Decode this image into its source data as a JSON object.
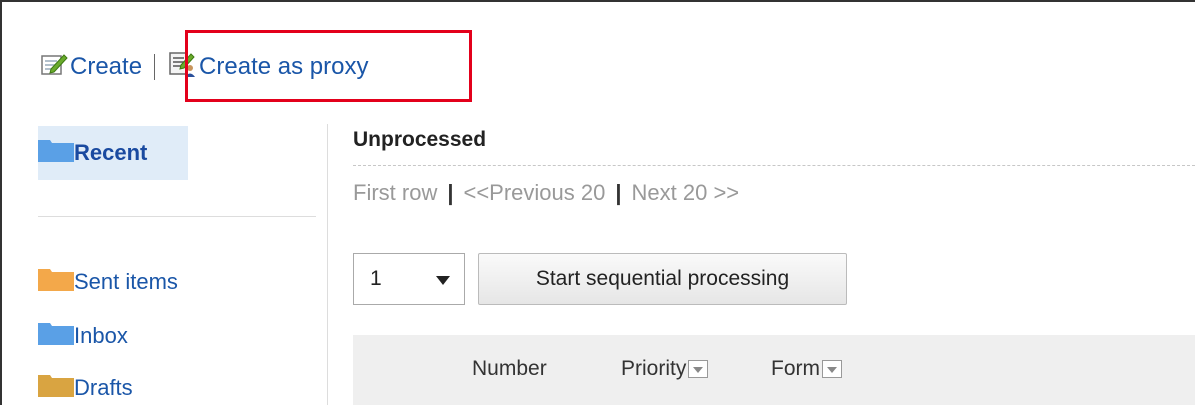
{
  "toolbar": {
    "create_label": "Create",
    "create_proxy_label": "Create as proxy"
  },
  "sidebar": {
    "recent_label": "Recent",
    "items": [
      {
        "label": "Sent items",
        "icon": "folder-orange-icon",
        "color": "#f3a84a"
      },
      {
        "label": "Inbox",
        "icon": "folder-blue-icon",
        "color": "#5aa0e6"
      },
      {
        "label": "Drafts",
        "icon": "folder-tan-icon",
        "color": "#d9a441"
      }
    ]
  },
  "main": {
    "title": "Unprocessed",
    "pager": {
      "first": "First row",
      "sep": "|",
      "prev": "<<Previous 20",
      "next": "Next 20 >>"
    },
    "select_value": "1",
    "sequential_button": "Start sequential processing",
    "columns": {
      "number": "Number",
      "priority": "Priority",
      "form": "Form"
    }
  },
  "colors": {
    "link": "#1a56a8",
    "highlight_border": "#e3001b",
    "selected_bg": "#e0ecf8"
  }
}
